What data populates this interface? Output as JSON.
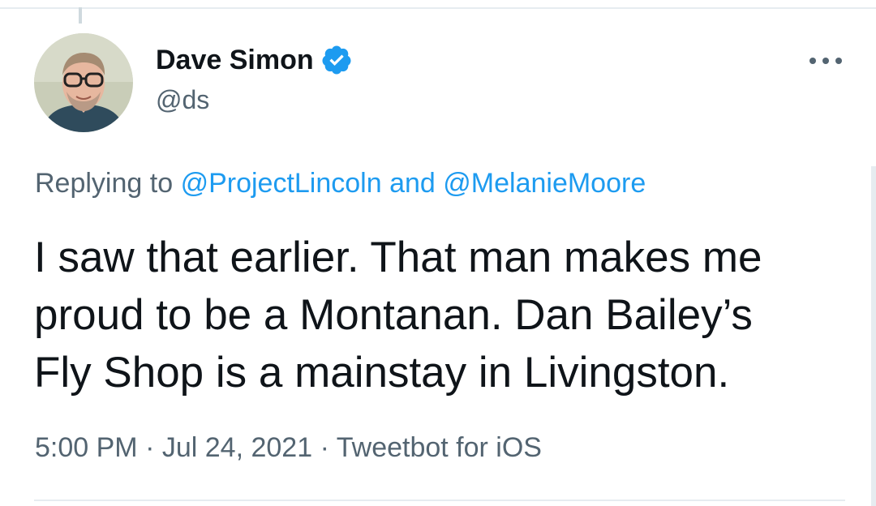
{
  "tweet": {
    "author": {
      "name": "Dave Simon",
      "handle": "@ds",
      "verified": true,
      "avatar_icon": "person-avatar"
    },
    "reply": {
      "prefix": "Replying to",
      "mentions": [
        "@ProjectLincoln",
        "@MelanieMoore"
      ],
      "joiner": "and"
    },
    "text_lines": [
      "I saw that earlier. That man makes me",
      "proud to be a Montanan. Dan Bailey’s",
      "Fly Shop is a mainstay in Livingston."
    ],
    "time": "5:00 PM",
    "date": "Jul 24, 2021",
    "source": "Tweetbot for iOS",
    "separator": "·"
  },
  "colors": {
    "text": "#0f1419",
    "secondary": "#536471",
    "accent": "#1d9bf0",
    "border": "#e6ecf0"
  },
  "icons": {
    "verified": "verified-badge-icon",
    "more": "more-options-icon"
  }
}
